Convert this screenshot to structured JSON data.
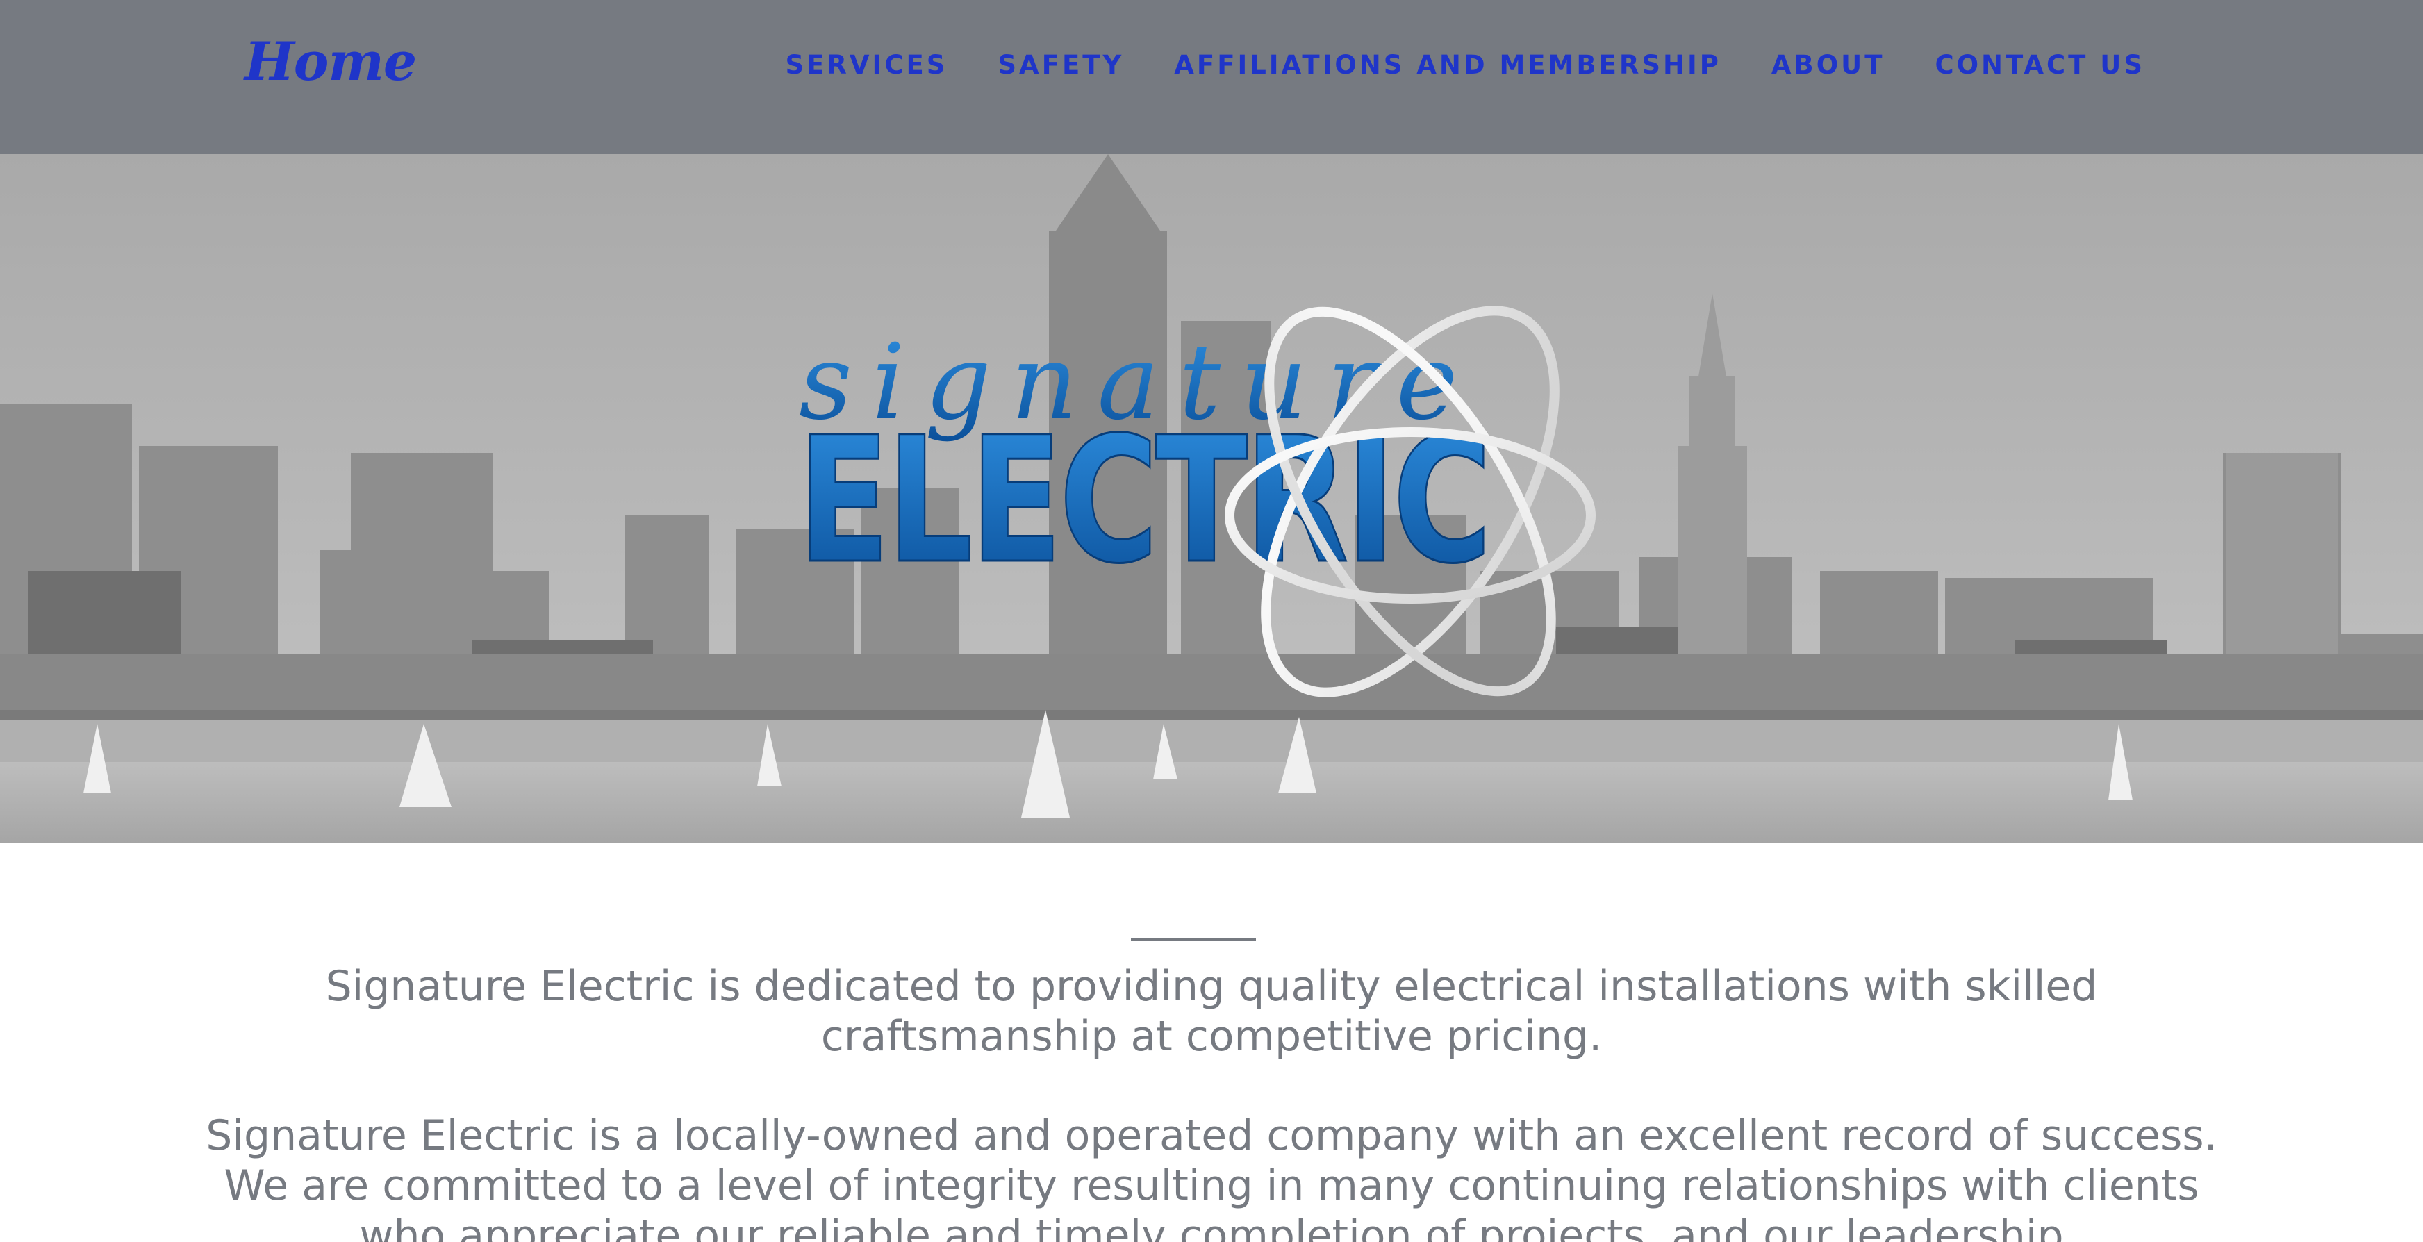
{
  "header": {
    "brand_label": "Home",
    "nav": [
      {
        "label": "SERVICES"
      },
      {
        "label": "SAFETY"
      },
      {
        "label": "AFFILIATIONS AND MEMBERSHIP"
      },
      {
        "label": "ABOUT"
      },
      {
        "label": "CONTACT US"
      }
    ]
  },
  "hero": {
    "logo_script": "signature",
    "logo_word": "ELECTRIC"
  },
  "main": {
    "paragraphs": [
      "Signature Electric is dedicated to providing quality electrical installations with skilled craftsmanship at competitive pricing.",
      "Signature Electric is a locally-owned and operated company with an excellent record of success. We are committed to a level of integrity resulting in many continuing relationships with clients who appreciate our reliable and timely completion of projects, and our leadership"
    ]
  },
  "colors": {
    "header_bg": "#767a81",
    "accent_blue": "#1f35c9",
    "text_gray": "#767a81",
    "logo_blue": "#0d6fc4"
  }
}
